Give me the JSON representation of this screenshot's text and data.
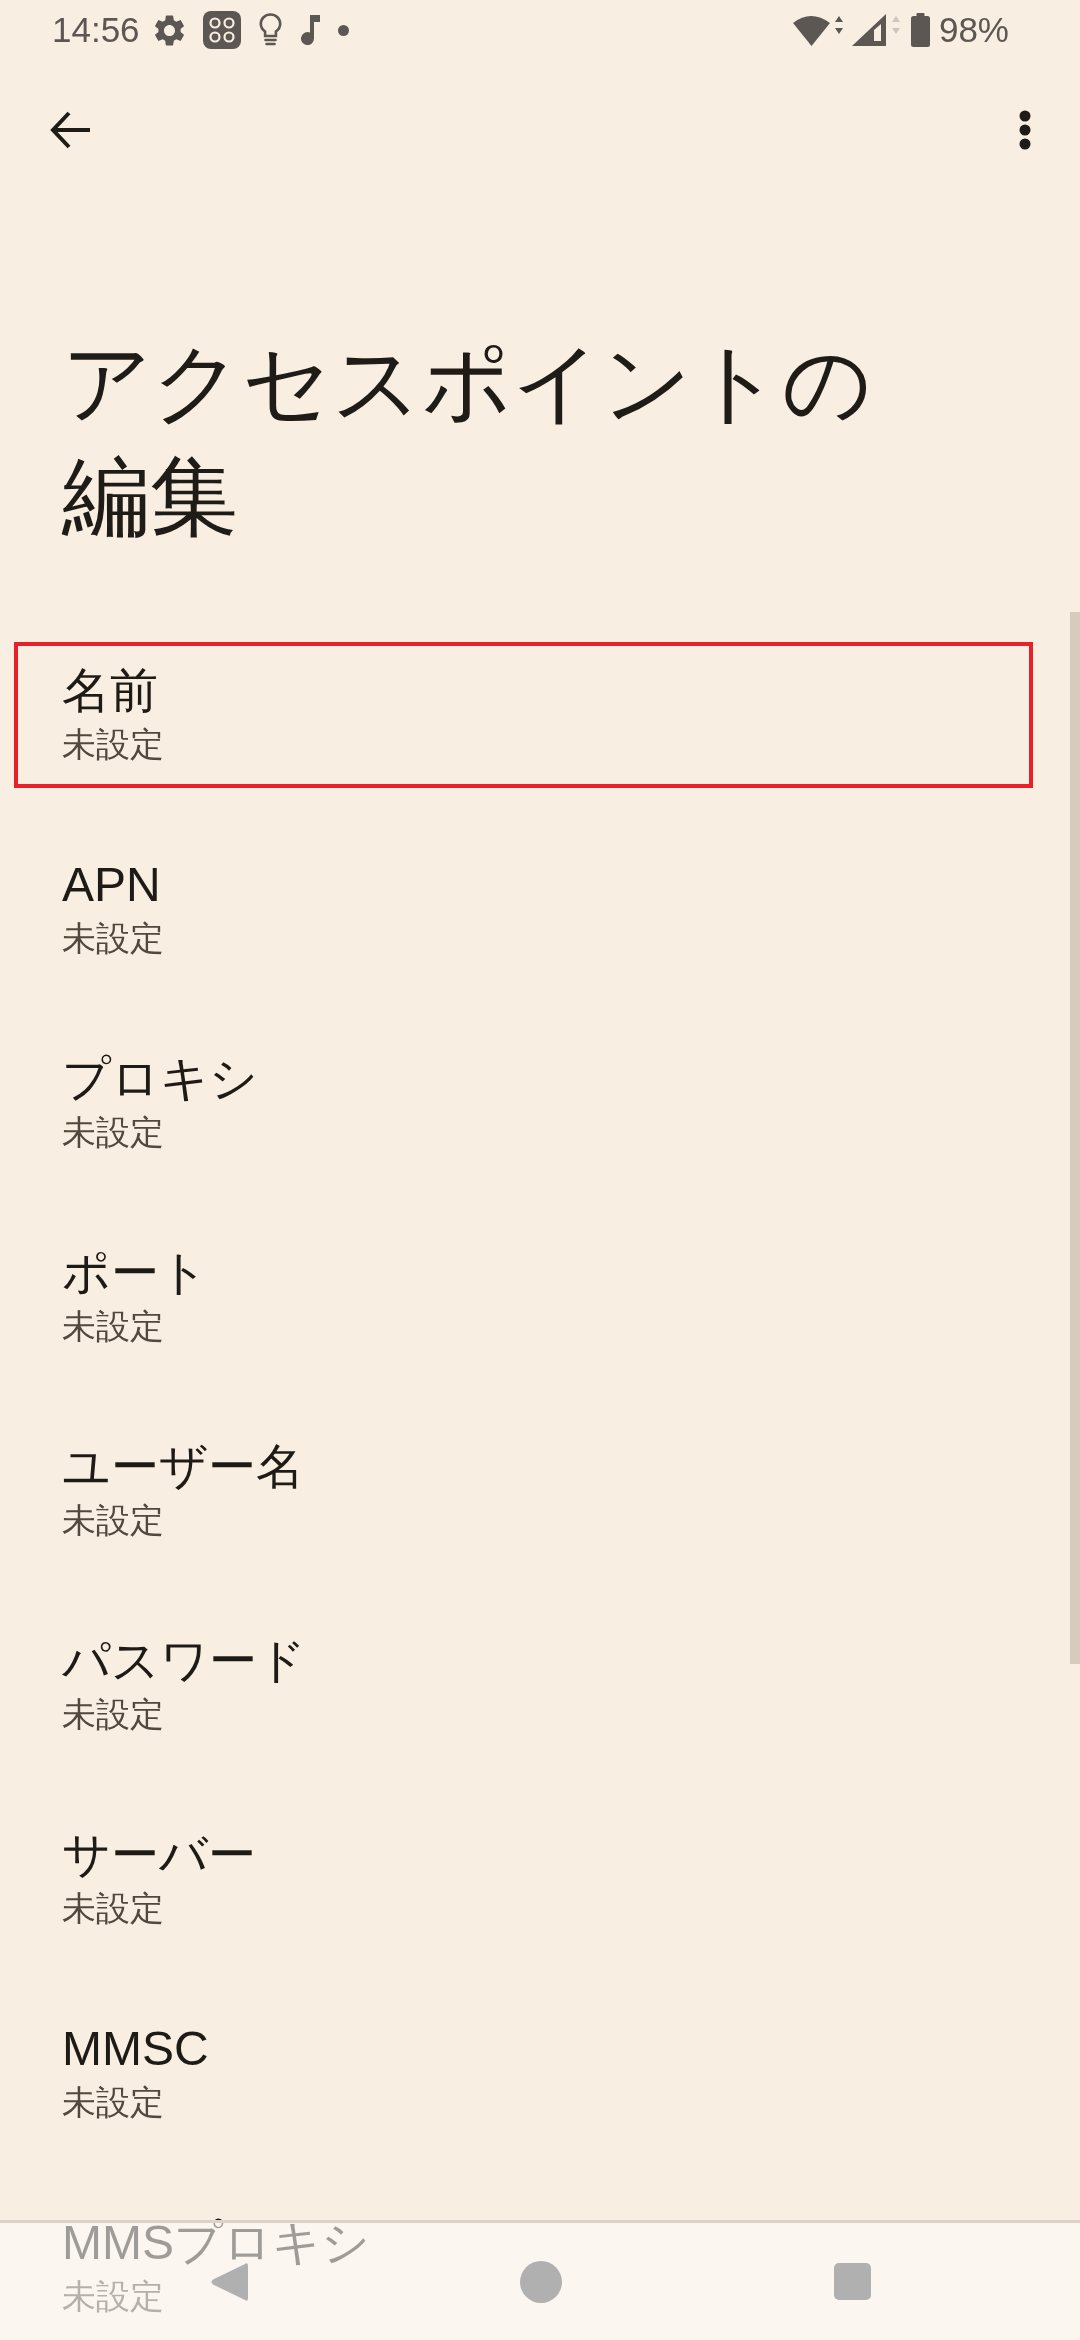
{
  "status_bar": {
    "time": "14:56",
    "battery": "98%"
  },
  "title": "アクセスポイントの編集",
  "preferences": [
    {
      "title": "名前",
      "summary": "未設定",
      "highlighted": true
    },
    {
      "title": "APN",
      "summary": "未設定",
      "highlighted": false
    },
    {
      "title": "プロキシ",
      "summary": "未設定",
      "highlighted": false
    },
    {
      "title": "ポート",
      "summary": "未設定",
      "highlighted": false
    },
    {
      "title": "ユーザー名",
      "summary": "未設定",
      "highlighted": false
    },
    {
      "title": "パスワード",
      "summary": "未設定",
      "highlighted": false
    },
    {
      "title": "サーバー",
      "summary": "未設定",
      "highlighted": false
    },
    {
      "title": "MMSC",
      "summary": "未設定",
      "highlighted": false
    },
    {
      "title": "MMSプロキシ",
      "summary": "未設定",
      "highlighted": false
    }
  ]
}
